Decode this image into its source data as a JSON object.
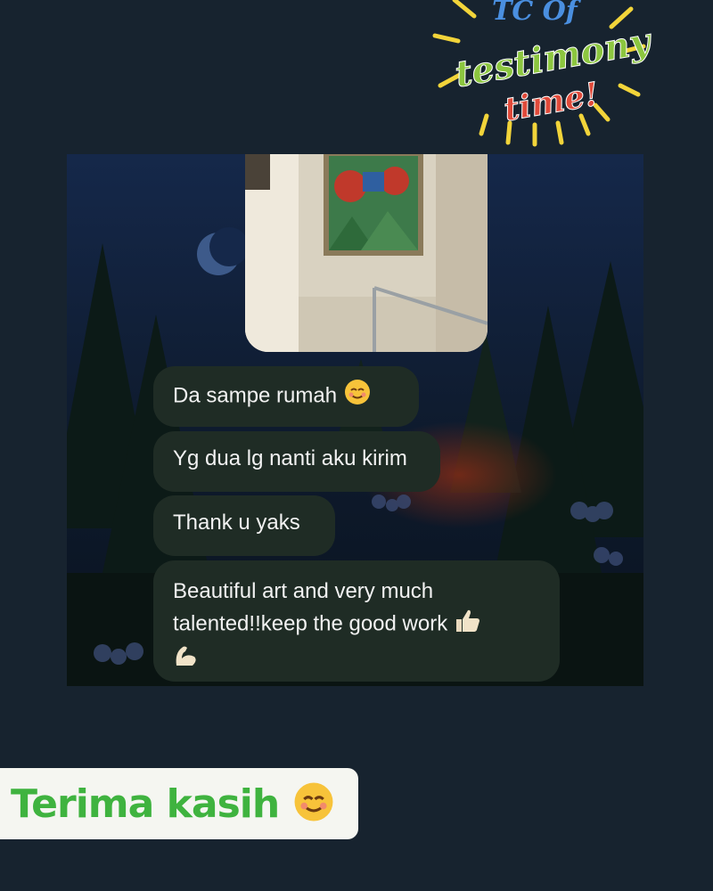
{
  "sticker": {
    "line1": "TC Of",
    "line2": "testimony",
    "line3": "time!"
  },
  "chat": {
    "messages": [
      {
        "text": "Da sampe rumah",
        "emoji": "smiling-face-icon"
      },
      {
        "text": "Yg dua lg nanti aku kirim"
      },
      {
        "text": "Thank u yaks"
      },
      {
        "text": "Beautiful art and very much talented!!keep the good work",
        "emoji": [
          "thumbs-up-icon",
          "flexed-biceps-icon"
        ]
      }
    ]
  },
  "footer": {
    "thanks_label": "Terima kasih",
    "emoji": "smiling-face-icon"
  },
  "colors": {
    "bubble": "#1f2c25",
    "label_text": "#3fb33f",
    "sticker_green": "#8cc63f",
    "sticker_red": "#e04a3a",
    "sticker_yellow": "#f2d43a"
  }
}
